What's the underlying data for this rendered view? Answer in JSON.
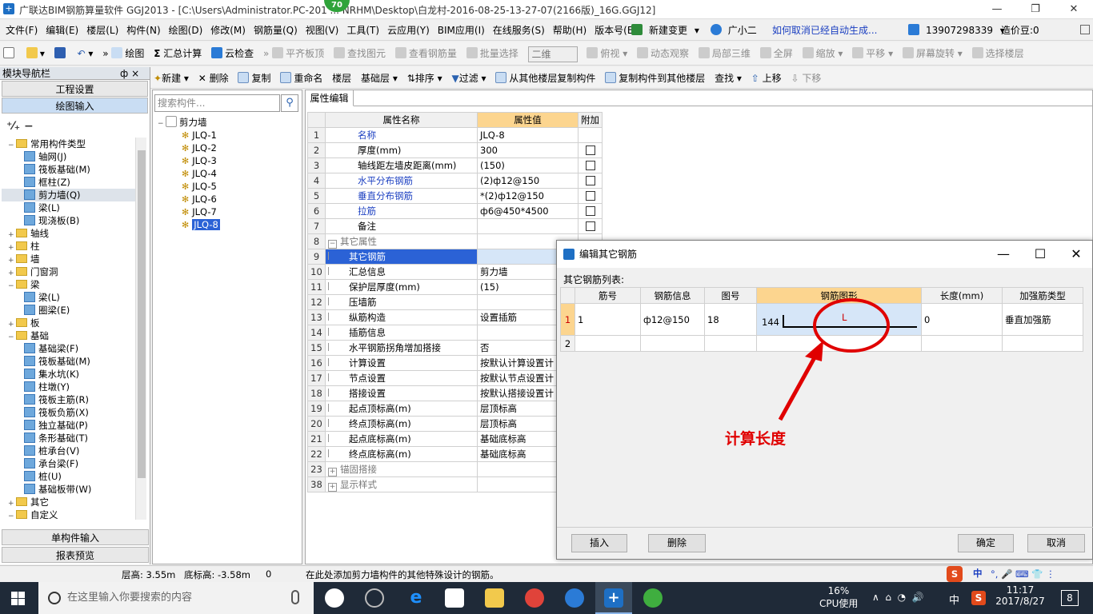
{
  "window": {
    "title": "广联达BIM钢筋算量软件 GGJ2013 - [C:\\Users\\Administrator.PC-201 ... NRHM\\Desktop\\白龙村-2016-08-25-13-27-07(2166版)_16G.GGJ12]",
    "badge": "70"
  },
  "menu": {
    "items": [
      "文件(F)",
      "编辑(E)",
      "楼层(L)",
      "构件(N)",
      "绘图(D)",
      "修改(M)",
      "钢筋量(Q)",
      "视图(V)",
      "工具(T)",
      "云应用(Y)",
      "BIM应用(I)",
      "在线服务(S)",
      "帮助(H)",
      "版本号(B)"
    ],
    "new_change": "新建变更",
    "assistant": "广小二",
    "tip": "如何取消已经自动生成...",
    "phone": "13907298339",
    "beans": "造价豆:0"
  },
  "toolbar": {
    "draw": "绘图",
    "sum_calc": "汇总计算",
    "cloud_check": "云检查",
    "flush_slab": "平齐板顶",
    "find_element": "查找图元",
    "view_rebar": "查看钢筋量",
    "batch_select": "批量选择",
    "view_mode": "二维",
    "ortho": "俯视",
    "dynamic": "动态观察",
    "local3d": "局部三维",
    "fullscreen": "全屏",
    "zoom": "缩放",
    "pan": "平移",
    "rotate": "屏幕旋转",
    "select_floor": "选择楼层"
  },
  "toolbar2": {
    "new": "新建",
    "delete": "删除",
    "copy": "复制",
    "rename": "重命名",
    "floor_label": "楼层",
    "floor_value": "基础层",
    "sort": "排序",
    "filter": "过滤",
    "copy_from": "从其他楼层复制构件",
    "copy_to": "复制构件到其他楼层",
    "find": "查找",
    "up": "上移",
    "down": "下移"
  },
  "nav": {
    "header": "模块导航栏",
    "pin": "ф ×",
    "project_settings": "工程设置",
    "draw_input": "绘图输入",
    "single_input": "单构件输入",
    "report_preview": "报表预览",
    "tree": [
      {
        "label": "常用构件类型",
        "level": 0,
        "kind": "folder",
        "exp": "−"
      },
      {
        "label": "轴网(J)",
        "level": 1,
        "kind": "comp"
      },
      {
        "label": "筏板基础(M)",
        "level": 1,
        "kind": "comp"
      },
      {
        "label": "框柱(Z)",
        "level": 1,
        "kind": "comp"
      },
      {
        "label": "剪力墙(Q)",
        "level": 1,
        "kind": "comp",
        "selected": true
      },
      {
        "label": "梁(L)",
        "level": 1,
        "kind": "comp"
      },
      {
        "label": "现浇板(B)",
        "level": 1,
        "kind": "comp"
      },
      {
        "label": "轴线",
        "level": 0,
        "kind": "folder",
        "exp": "+"
      },
      {
        "label": "柱",
        "level": 0,
        "kind": "folder",
        "exp": "+"
      },
      {
        "label": "墙",
        "level": 0,
        "kind": "folder",
        "exp": "+"
      },
      {
        "label": "门窗洞",
        "level": 0,
        "kind": "folder",
        "exp": "+"
      },
      {
        "label": "梁",
        "level": 0,
        "kind": "folder",
        "exp": "−"
      },
      {
        "label": "梁(L)",
        "level": 1,
        "kind": "comp"
      },
      {
        "label": "圈梁(E)",
        "level": 1,
        "kind": "comp"
      },
      {
        "label": "板",
        "level": 0,
        "kind": "folder",
        "exp": "+"
      },
      {
        "label": "基础",
        "level": 0,
        "kind": "folder",
        "exp": "−"
      },
      {
        "label": "基础梁(F)",
        "level": 1,
        "kind": "comp"
      },
      {
        "label": "筏板基础(M)",
        "level": 1,
        "kind": "comp"
      },
      {
        "label": "集水坑(K)",
        "level": 1,
        "kind": "comp"
      },
      {
        "label": "柱墩(Y)",
        "level": 1,
        "kind": "comp"
      },
      {
        "label": "筏板主筋(R)",
        "level": 1,
        "kind": "comp"
      },
      {
        "label": "筏板负筋(X)",
        "level": 1,
        "kind": "comp"
      },
      {
        "label": "独立基础(P)",
        "level": 1,
        "kind": "comp"
      },
      {
        "label": "条形基础(T)",
        "level": 1,
        "kind": "comp"
      },
      {
        "label": "桩承台(V)",
        "level": 1,
        "kind": "comp"
      },
      {
        "label": "承台梁(F)",
        "level": 1,
        "kind": "comp"
      },
      {
        "label": "桩(U)",
        "level": 1,
        "kind": "comp"
      },
      {
        "label": "基础板带(W)",
        "level": 1,
        "kind": "comp"
      },
      {
        "label": "其它",
        "level": 0,
        "kind": "folder",
        "exp": "+"
      },
      {
        "label": "自定义",
        "level": 0,
        "kind": "folder",
        "exp": "−"
      }
    ]
  },
  "components": {
    "search_placeholder": "搜索构件...",
    "root": "剪力墙",
    "items": [
      "JLQ-1",
      "JLQ-2",
      "JLQ-3",
      "JLQ-4",
      "JLQ-5",
      "JLQ-6",
      "JLQ-7",
      "JLQ-8"
    ],
    "selected_index": 7
  },
  "props": {
    "tab": "属性编辑",
    "headers": [
      "属性名称",
      "属性值",
      "附加"
    ],
    "rows": [
      {
        "n": "1",
        "name": "名称",
        "value": "JLQ-8",
        "blue": true,
        "check": null
      },
      {
        "n": "2",
        "name": "厚度(mm)",
        "value": "300",
        "check": false
      },
      {
        "n": "3",
        "name": "轴线距左墙皮距离(mm)",
        "value": "(150)",
        "check": false
      },
      {
        "n": "4",
        "name": "水平分布钢筋",
        "value": "(2)ф12@150",
        "blue": true,
        "check": false
      },
      {
        "n": "5",
        "name": "垂直分布钢筋",
        "value": "*(2)ф12@150",
        "blue": true,
        "check": false
      },
      {
        "n": "6",
        "name": "拉筋",
        "value": "ф6@450*4500",
        "blue": true,
        "check": false
      },
      {
        "n": "7",
        "name": "备注",
        "value": "",
        "check": false
      },
      {
        "n": "8",
        "name": "其它属性",
        "value": "",
        "group": true,
        "exp": "−"
      },
      {
        "n": "9",
        "name": "其它钢筋",
        "value": "",
        "selected": true,
        "indent": true
      },
      {
        "n": "10",
        "name": "汇总信息",
        "value": "剪力墙",
        "indent": true
      },
      {
        "n": "11",
        "name": "保护层厚度(mm)",
        "value": "(15)",
        "indent": true
      },
      {
        "n": "12",
        "name": "压墙筋",
        "value": "",
        "indent": true
      },
      {
        "n": "13",
        "name": "纵筋构造",
        "value": "设置插筋",
        "indent": true
      },
      {
        "n": "14",
        "name": "插筋信息",
        "value": "",
        "indent": true
      },
      {
        "n": "15",
        "name": "水平钢筋拐角增加搭接",
        "value": "否",
        "indent": true
      },
      {
        "n": "16",
        "name": "计算设置",
        "value": "按默认计算设置计",
        "indent": true
      },
      {
        "n": "17",
        "name": "节点设置",
        "value": "按默认节点设置计",
        "indent": true
      },
      {
        "n": "18",
        "name": "搭接设置",
        "value": "按默认搭接设置计",
        "indent": true
      },
      {
        "n": "19",
        "name": "起点顶标高(m)",
        "value": "层顶标高",
        "indent": true
      },
      {
        "n": "20",
        "name": "终点顶标高(m)",
        "value": "层顶标高",
        "indent": true
      },
      {
        "n": "21",
        "name": "起点底标高(m)",
        "value": "基础底标高",
        "indent": true
      },
      {
        "n": "22",
        "name": "终点底标高(m)",
        "value": "基础底标高",
        "indent": true
      },
      {
        "n": "23",
        "name": "锚固搭接",
        "value": "",
        "group": true,
        "exp": "+"
      },
      {
        "n": "38",
        "name": "显示样式",
        "value": "",
        "group": true,
        "exp": "+"
      }
    ]
  },
  "dialog": {
    "title": "编辑其它钢筋",
    "list_label": "其它钢筋列表:",
    "headers": [
      "筋号",
      "钢筋信息",
      "图号",
      "钢筋图形",
      "长度(mm)",
      "加强筋类型"
    ],
    "rows": [
      {
        "n": "1",
        "bar_no": "1",
        "info": "ф12@150",
        "fig": "18",
        "shape_dim": "144",
        "shape_label": "L",
        "length": "0",
        "type": "垂直加强筋"
      },
      {
        "n": "2",
        "bar_no": "",
        "info": "",
        "fig": "",
        "shape_dim": "",
        "shape_label": "",
        "length": "",
        "type": ""
      }
    ],
    "insert": "插入",
    "delete": "删除",
    "ok": "确定",
    "cancel": "取消"
  },
  "annotation": {
    "text": "计算长度",
    "color": "#e00000"
  },
  "status": {
    "floor_height": "层高: 3.55m",
    "bottom_elev": "底标高: -3.58m",
    "zero": "0",
    "hint": "在此处添加剪力墙构件的其他特殊设计的钢筋。",
    "ime": "中"
  },
  "taskbar": {
    "search_placeholder": "在这里输入你要搜索的内容",
    "cpu_pct": "16%",
    "cpu_label": "CPU使用",
    "lang": "中",
    "time": "11:17",
    "date": "2017/8/27",
    "notif": "8"
  }
}
